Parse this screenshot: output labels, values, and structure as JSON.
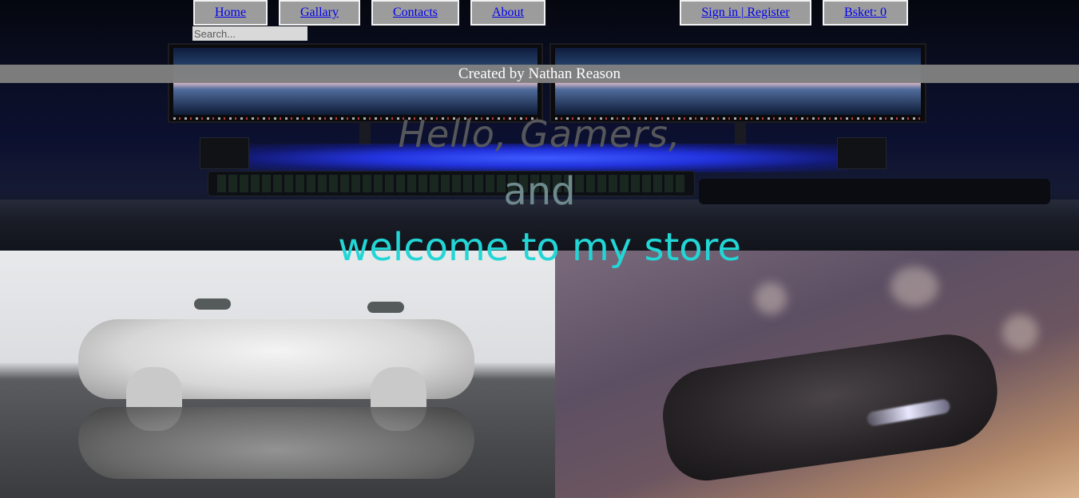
{
  "nav": {
    "items": [
      {
        "label": "Home"
      },
      {
        "label": "Gallary"
      },
      {
        "label": "Contacts"
      },
      {
        "label": "About"
      }
    ],
    "signin_label": "Sign in | Register",
    "basket_label": "Bsket: 0"
  },
  "search": {
    "placeholder": "Search...",
    "value": ""
  },
  "credit": {
    "text": "Created by Nathan Reason"
  },
  "hero": {
    "line1": "Hello, Gamers,",
    "line2": "and",
    "line3": "welcome to my store"
  },
  "colors": {
    "nav_button_bg": "#9c9c9c",
    "link": "#0000ee",
    "credit_bar_bg": "#808080",
    "headline_line1": "#55575a",
    "headline_line2": "#6e8a8c",
    "headline_line3": "#23d6d6"
  }
}
